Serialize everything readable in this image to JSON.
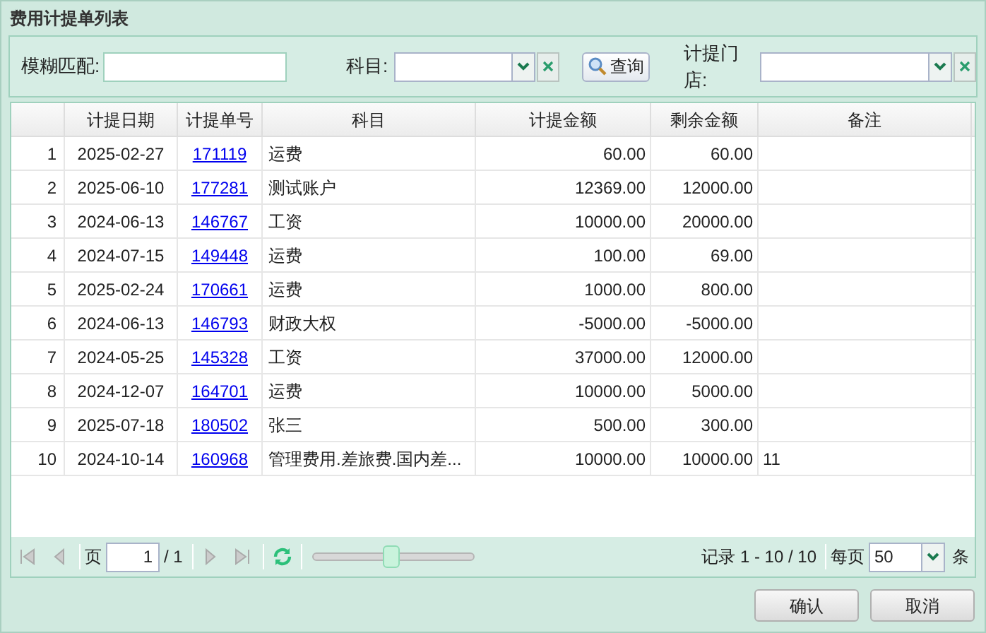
{
  "window": {
    "title": "费用计提单列表"
  },
  "filters": {
    "fuzzy_label": "模糊匹配:",
    "subject_label": "科目:",
    "query_button": "查询",
    "store_label": "计提门店:"
  },
  "table": {
    "columns": [
      "计提日期",
      "计提单号",
      "科目",
      "计提金额",
      "剩余金额",
      "备注"
    ],
    "rows": [
      {
        "index": "1",
        "date": "2025-02-27",
        "number": "171119",
        "subject": "运费",
        "amount": "60.00",
        "remaining": "60.00"
      },
      {
        "index": "2",
        "date": "2025-06-10",
        "number": "177281",
        "subject": "测试账户",
        "amount": "12369.00",
        "remaining": "12000.00"
      },
      {
        "index": "3",
        "date": "2024-06-13",
        "number": "146767",
        "subject": "工资",
        "amount": "10000.00",
        "remaining": "20000.00"
      },
      {
        "index": "4",
        "date": "2024-07-15",
        "number": "149448",
        "subject": "运费",
        "amount": "100.00",
        "remaining": "69.00"
      },
      {
        "index": "5",
        "date": "2025-02-24",
        "number": "170661",
        "subject": "运费",
        "amount": "1000.00",
        "remaining": "800.00"
      },
      {
        "index": "6",
        "date": "2024-06-13",
        "number": "146793",
        "subject": "财政大权",
        "amount": "-5000.00",
        "remaining": "-5000.00"
      },
      {
        "index": "7",
        "date": "2024-05-25",
        "number": "145328",
        "subject": "工资",
        "amount": "37000.00",
        "remaining": "12000.00"
      },
      {
        "index": "8",
        "date": "2024-12-07",
        "number": "164701",
        "subject": "运费",
        "amount": "10000.00",
        "remaining": "5000.00"
      },
      {
        "index": "9",
        "date": "2025-07-18",
        "number": "180502",
        "subject": "张三",
        "amount": "500.00",
        "remaining": "300.00"
      },
      {
        "index": "10",
        "date": "2024-10-14",
        "number": "160968",
        "subject": "管理费用.差旅费.国内差...",
        "amount": "10000.00",
        "remaining": "10000.00",
        "note": "11"
      }
    ]
  },
  "pager": {
    "page_label": "页",
    "page": "1",
    "total_pages": "/ 1",
    "zoom": {
      "level": 0.47
    },
    "records": "记录 1 - 10 / 10",
    "per_page_label": "每页",
    "per_page": "50",
    "per_page_unit": "条"
  },
  "buttons": [
    "确认",
    "取消"
  ]
}
